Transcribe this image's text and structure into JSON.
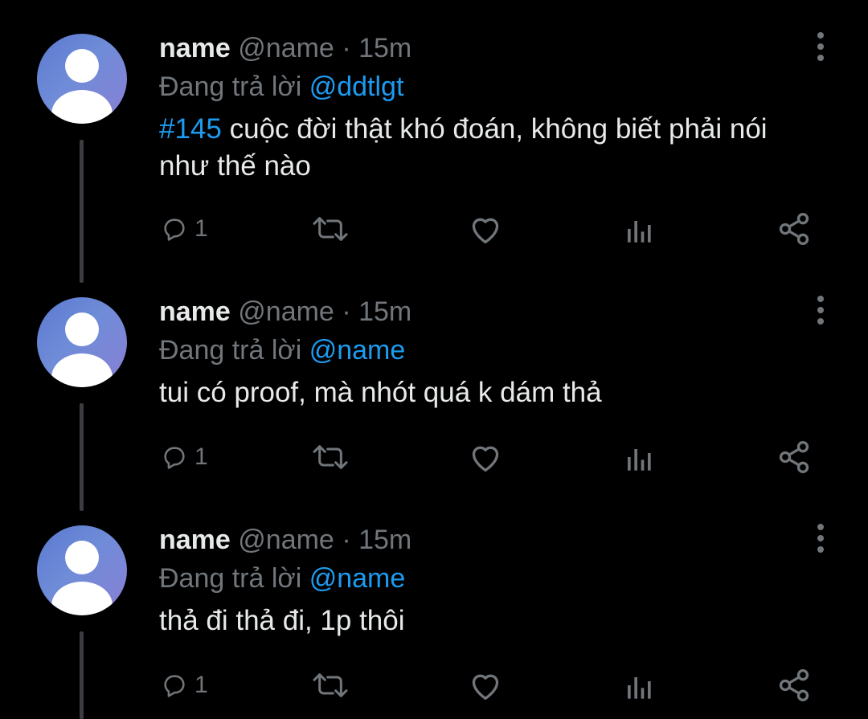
{
  "tweets": [
    {
      "name": "name",
      "handle": "@name",
      "separator": "·",
      "time": "15m",
      "reply_prefix": "Đang trả lời",
      "reply_to": "@ddtlgt",
      "hashtag": "#145",
      "text": " cuộc đời thật khó đoán, không biết phải nói như thế nào",
      "reply_count": "1"
    },
    {
      "name": "name",
      "handle": "@name",
      "separator": "·",
      "time": "15m",
      "reply_prefix": "Đang trả lời",
      "reply_to": "@name",
      "hashtag": "",
      "text": "tui có proof, mà nhót quá k dám thả",
      "reply_count": "1"
    },
    {
      "name": "name",
      "handle": "@name",
      "separator": "·",
      "time": "15m",
      "reply_prefix": "Đang trả lời",
      "reply_to": "@name",
      "hashtag": "",
      "text": "thả đi thả đi, 1p thôi",
      "reply_count": "1"
    }
  ],
  "icons": {
    "reply": "reply-icon",
    "retweet": "retweet-icon",
    "like": "heart-icon",
    "views": "views-icon",
    "share": "share-icon",
    "more": "more-vertical-icon"
  },
  "colors": {
    "background": "#000000",
    "text": "#e7e9ea",
    "muted": "#71767b",
    "accent": "#1d9bf0",
    "thread_line": "#3a3d41"
  }
}
